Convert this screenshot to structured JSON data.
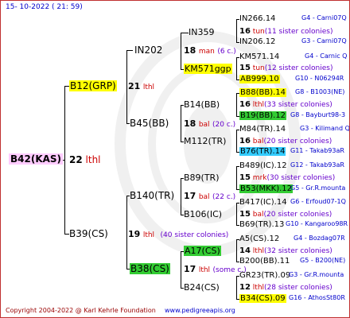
{
  "header": {
    "date": "15- 10-2022 ( 21: 59)"
  },
  "footer": {
    "copyright": "Copyright 2004-2022 @ Karl Kehrle Foundation",
    "site": "www.pedigreeapis.org"
  },
  "colors": {
    "yellow": "#ffff00",
    "green": "#33cc33",
    "cyan": "#33ccff",
    "pink": "#ffccff",
    "red": "#cc0000",
    "blue": "#0000cc",
    "purple": "#6600cc",
    "maroon": "#990000"
  },
  "tree": {
    "root": {
      "label": "B42(KAS)",
      "gen": "22",
      "tag": "lthl"
    },
    "p1": {
      "label": "B12(GRP)",
      "gen": "21",
      "tag": "lthl"
    },
    "p2": {
      "label": "B39(CS)",
      "gen": "19",
      "tag": "lthl",
      "note": "(40 sister colonies)"
    },
    "gp1": {
      "label": "IN202",
      "gen": "18",
      "tag": "man",
      "note": "(6 c.)"
    },
    "gp2": {
      "label": "B45(BB)",
      "gen": "18",
      "tag": "bal",
      "note": "(20 c.)"
    },
    "gp3": {
      "label": "B140(TR)",
      "gen": "17",
      "tag": "bal",
      "note": "(22 c.)"
    },
    "gp4": {
      "label": "B38(CS)",
      "gen": "17",
      "tag": "lthl",
      "note": "(some c.)"
    },
    "ggp1": {
      "label": "IN359"
    },
    "ggp2": {
      "label": "KM571ggp"
    },
    "ggp3": {
      "label": "B14(BB)",
      "gen": "16",
      "tag": "lthl",
      "note": "(33 sister colonies)"
    },
    "ggp4": {
      "label": "M112(TR)",
      "gen": "16",
      "tag": "bal",
      "note": "(20 sister colonies)"
    },
    "ggp5": {
      "label": "B89(TR)",
      "gen": "15",
      "tag": "mrk",
      "note": "(30 sister colonies)"
    },
    "ggp6": {
      "label": "B106(IC)",
      "gen": "15",
      "tag": "bal",
      "note": "(20 sister colonies)"
    },
    "ggp7": {
      "label": "A17(CS)",
      "gen": "14",
      "tag": "lthl",
      "note": "(32 sister colonies)"
    },
    "ggp8": {
      "label": "B24(CS)",
      "gen": "12",
      "tag": "lthl",
      "note": "(28 sister colonies)"
    },
    "in359_gen": "16",
    "in359_tag": "tun",
    "in359_note": "(11 sister colonies)",
    "km571_gen": "15",
    "km571_tag": "tun",
    "km571_note": "(12 sister colonies)",
    "leaves": [
      {
        "name": "IN266.14",
        "code": "G4 - Carni07Q"
      },
      {
        "name": "IN206.12",
        "code": "G3 - Carni07Q"
      },
      {
        "name": "KM571.14",
        "code": "G4 - Carnic Q"
      },
      {
        "name": "AB999.10",
        "code": "G10 - N06294R"
      },
      {
        "name": "B88(BB).14",
        "code": "G8 - B1003(NE)"
      },
      {
        "name": "B19(BB).12",
        "code": "G8 - Bayburt98-3"
      },
      {
        "name": "M84(TR).14",
        "code": "G3 - Kilimand Q"
      },
      {
        "name": "B76(TR).14",
        "code": "G11 - Takab93aR"
      },
      {
        "name": "B489(IC).12",
        "code": "G12 - Takab93aR"
      },
      {
        "name": "B53(MKK).12",
        "code": "G5 - Gr.R.mounta"
      },
      {
        "name": "B417(IC).14",
        "code": "G6 - Erfoud07-1Q"
      },
      {
        "name": "B69(TR).13",
        "code": "G10 - Kangaroo98R"
      },
      {
        "name": "A5(CS).12",
        "code": "G4 - Bozdag07R"
      },
      {
        "name": "B200(BB).11",
        "code": "G5 - B200(NE)"
      },
      {
        "name": "GR23(TR).09",
        "code": "G3 - Gr.R.mounta"
      },
      {
        "name": "B34(CS).09",
        "code": "G16 - AthosSt80R"
      }
    ]
  }
}
